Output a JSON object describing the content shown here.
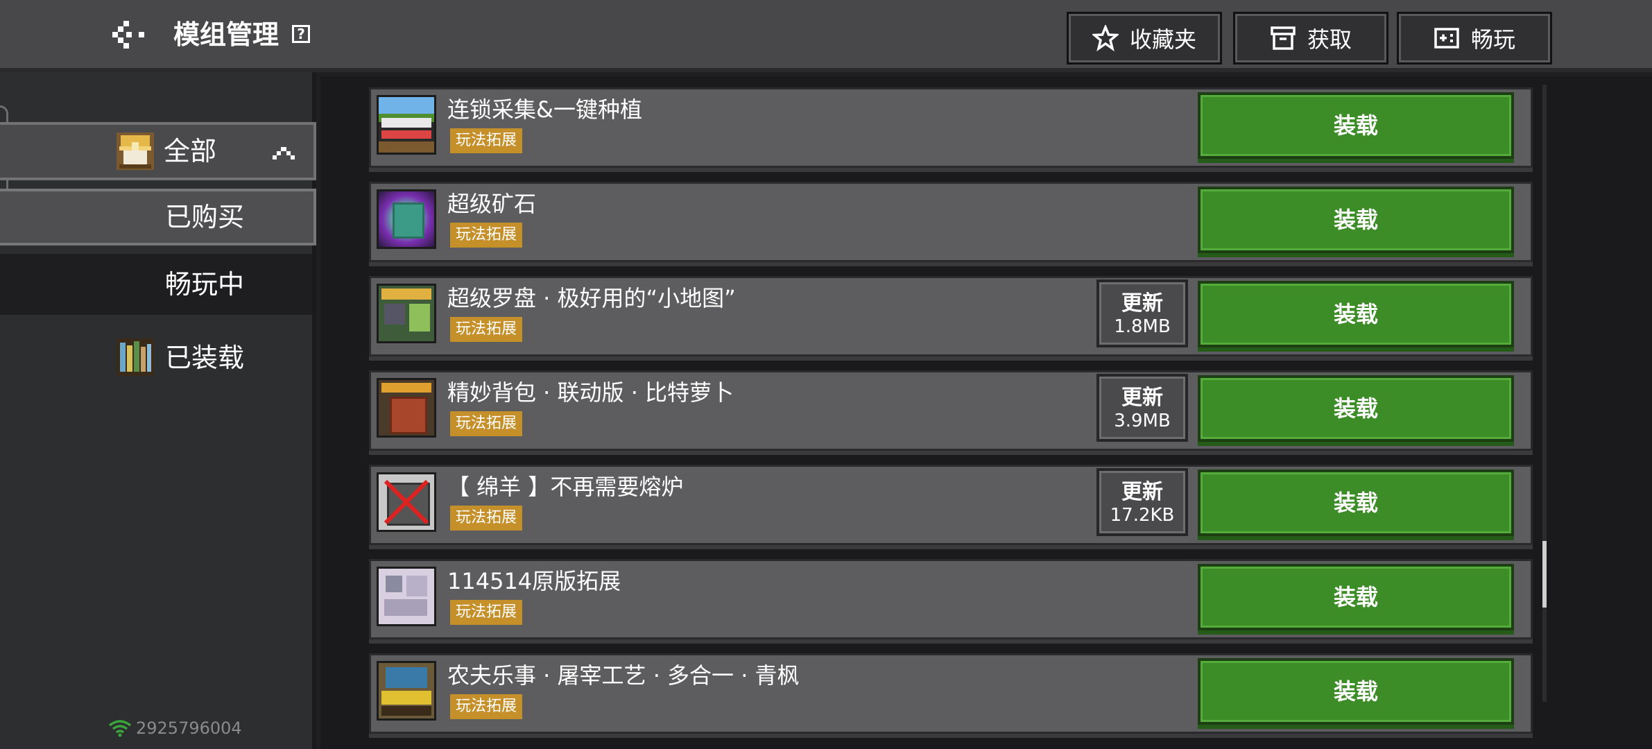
{
  "header": {
    "title": "模组管理",
    "help": "?",
    "favorites_label": "收藏夹",
    "get_label": "获取",
    "play_label": "畅玩"
  },
  "sidebar": {
    "all_label": "全部",
    "bought_label": "已购买",
    "playing_label": "畅玩中",
    "installed_label": "已装载",
    "account_id": "2925796004"
  },
  "mods": [
    {
      "name": "连锁采集&一键种植",
      "tag": "玩法拓展",
      "update": null,
      "action": "装载"
    },
    {
      "name": "超级矿石",
      "tag": "玩法拓展",
      "update": null,
      "action": "装载"
    },
    {
      "name": "超级罗盘 · 极好用的“小地图”",
      "tag": "玩法拓展",
      "update": {
        "label": "更新",
        "size": "1.8MB"
      },
      "action": "装载"
    },
    {
      "name": "精妙背包 · 联动版 · 比特萝卜",
      "tag": "玩法拓展",
      "update": {
        "label": "更新",
        "size": "3.9MB"
      },
      "action": "装载"
    },
    {
      "name": "【 绵羊 】不再需要熔炉",
      "tag": "玩法拓展",
      "update": {
        "label": "更新",
        "size": "17.2KB"
      },
      "action": "装载"
    },
    {
      "name": "114514原版拓展",
      "tag": "玩法拓展",
      "update": null,
      "action": "装载"
    },
    {
      "name": "农夫乐事 · 屠宰工艺 · 多合一 · 青枫",
      "tag": "玩法拓展",
      "update": null,
      "action": "装载"
    }
  ],
  "colors": {
    "install_green": "#3c8c28",
    "tag_orange": "#c58f2a",
    "row_bg": "#5d5d5f"
  }
}
